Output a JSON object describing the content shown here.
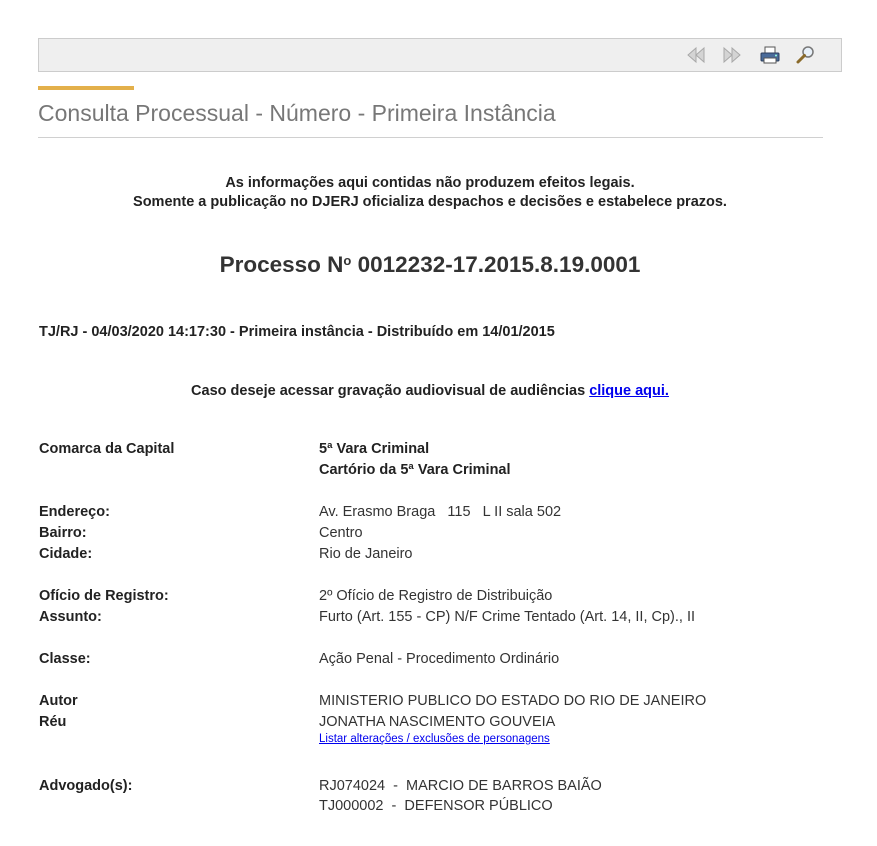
{
  "toolbar": {
    "icons": [
      "first-page-icon",
      "next-page-icon",
      "print-icon",
      "zoom-icon"
    ]
  },
  "colors": {
    "accent": "#e3b04b",
    "link": "#0000ee",
    "title": "#777777"
  },
  "page": {
    "title": "Consulta Processual - Número - Primeira Instância"
  },
  "disclaimer": {
    "line1": "As informações aqui contidas não produzem efeitos legais.",
    "line2": "Somente a publicação no DJERJ oficializa despachos e decisões e estabelece prazos."
  },
  "process": {
    "prefix": "Processo N",
    "superscript": "o",
    "number": "0012232-17.2015.8.19.0001",
    "subline": "TJ/RJ - 04/03/2020 14:17:30 - Primeira instância - Distribuído em 14/01/2015"
  },
  "audiovisual": {
    "text": "Caso deseje acessar gravação audiovisual de audiências",
    "link": "clique aqui."
  },
  "details": {
    "comarca_label": "Comarca da Capital",
    "vara": "5ª Vara Criminal",
    "cartorio": "Cartório da 5ª Vara Criminal",
    "endereco_label": "Endereço:",
    "endereco": "Av. Erasmo Braga   115   L II sala 502",
    "bairro_label": "Bairro:",
    "bairro": "Centro",
    "cidade_label": "Cidade:",
    "cidade": "Rio de Janeiro",
    "oficio_label": "Ofício de Registro:",
    "oficio": "2º Ofício de Registro de Distribuição",
    "assunto_label": "Assunto:",
    "assunto": "Furto (Art. 155 - CP) N/F Crime Tentado (Art. 14, II, Cp)., II",
    "classe_label": "Classe:",
    "classe": "Ação Penal - Procedimento Ordinário",
    "autor_label": "Autor",
    "autor": "MINISTERIO PUBLICO DO ESTADO DO RIO DE JANEIRO",
    "reu_label": "Réu",
    "reu": "JONATHA NASCIMENTO GOUVEIA",
    "personagens_link": "Listar alterações / exclusões de personagens",
    "advogados_label": "Advogado(s):",
    "advogado1": "RJ074024  -  MARCIO DE BARROS BAIÃO",
    "advogado2": "TJ000002  -  DEFENSOR PÚBLICO"
  }
}
